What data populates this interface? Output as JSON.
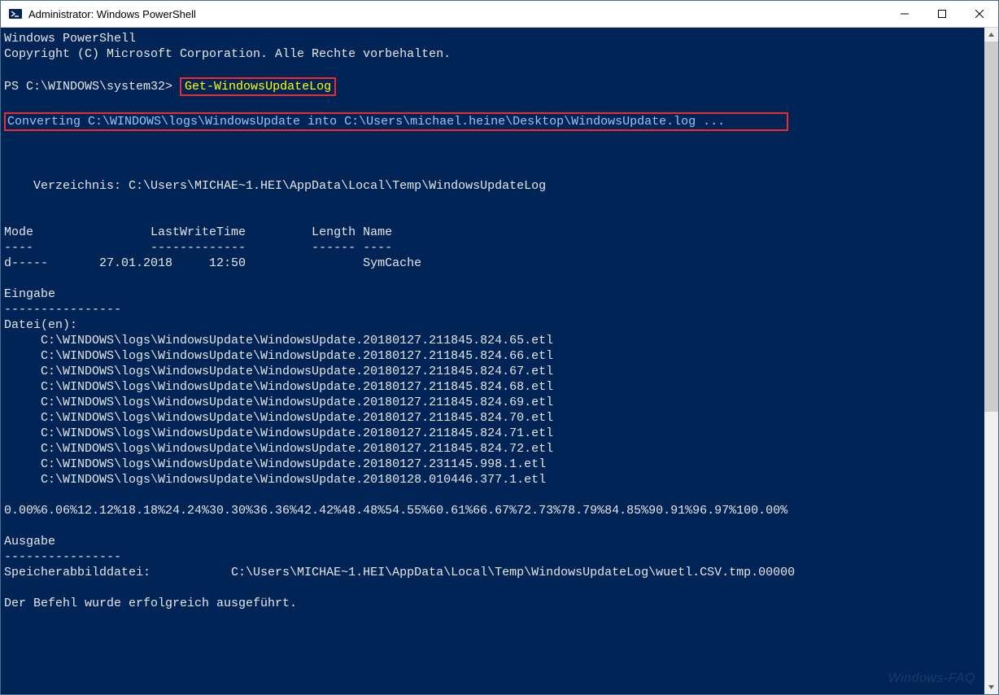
{
  "window": {
    "title": "Administrator: Windows PowerShell"
  },
  "terminal": {
    "header1": "Windows PowerShell",
    "header2": "Copyright (C) Microsoft Corporation. Alle Rechte vorbehalten.",
    "prompt": "PS C:\\WINDOWS\\system32> ",
    "command": "Get-WindowsUpdateLog",
    "converting": "Converting C:\\WINDOWS\\logs\\WindowsUpdate into C:\\Users\\michael.heine\\Desktop\\WindowsUpdate.log ...",
    "dirline": "    Verzeichnis: C:\\Users\\MICHAE~1.HEI\\AppData\\Local\\Temp\\WindowsUpdateLog",
    "table_header": "Mode                LastWriteTime         Length Name",
    "table_sep": "----                -------------         ------ ----",
    "table_row": "d-----       27.01.2018     12:50                SymCache",
    "eingabe": "Eingabe",
    "eingabe_sep": "----------------",
    "dateien": "Datei(en):",
    "files": [
      "     C:\\WINDOWS\\logs\\WindowsUpdate\\WindowsUpdate.20180127.211845.824.65.etl",
      "     C:\\WINDOWS\\logs\\WindowsUpdate\\WindowsUpdate.20180127.211845.824.66.etl",
      "     C:\\WINDOWS\\logs\\WindowsUpdate\\WindowsUpdate.20180127.211845.824.67.etl",
      "     C:\\WINDOWS\\logs\\WindowsUpdate\\WindowsUpdate.20180127.211845.824.68.etl",
      "     C:\\WINDOWS\\logs\\WindowsUpdate\\WindowsUpdate.20180127.211845.824.69.etl",
      "     C:\\WINDOWS\\logs\\WindowsUpdate\\WindowsUpdate.20180127.211845.824.70.etl",
      "     C:\\WINDOWS\\logs\\WindowsUpdate\\WindowsUpdate.20180127.211845.824.71.etl",
      "     C:\\WINDOWS\\logs\\WindowsUpdate\\WindowsUpdate.20180127.211845.824.72.etl",
      "     C:\\WINDOWS\\logs\\WindowsUpdate\\WindowsUpdate.20180127.231145.998.1.etl",
      "     C:\\WINDOWS\\logs\\WindowsUpdate\\WindowsUpdate.20180128.010446.377.1.etl"
    ],
    "progress": "0.00%6.06%12.12%18.18%24.24%30.30%36.36%42.42%48.48%54.55%60.61%66.67%72.73%78.79%84.85%90.91%96.97%100.00%",
    "ausgabe": "Ausgabe",
    "ausgabe_sep": "----------------",
    "dumpfile": "Speicherabbilddatei:           C:\\Users\\MICHAE~1.HEI\\AppData\\Local\\Temp\\WindowsUpdateLog\\wuetl.CSV.tmp.00000",
    "success": "Der Befehl wurde erfolgreich ausgeführt."
  },
  "watermark": "Windows-FAQ"
}
